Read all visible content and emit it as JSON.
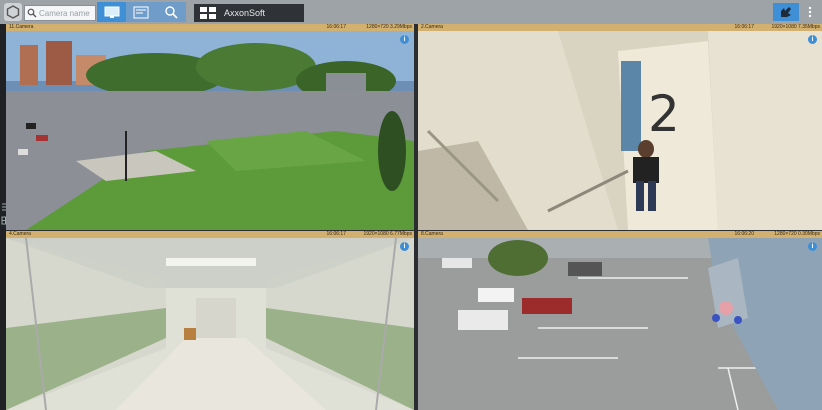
{
  "toolbar": {
    "search_placeholder": "Camera name",
    "layout_name": "AxxonSoft"
  },
  "cameras": [
    {
      "name": "11.Camera",
      "time": "16:06:17",
      "resolution": "1280×720 3.29Mbps"
    },
    {
      "name": "2.Camera",
      "time": "16:06:17",
      "resolution": "1920×1080 7.35Mbps"
    },
    {
      "name": "4.Camera",
      "time": "16:06:17",
      "resolution": "1920×1080 6.77Mbps"
    },
    {
      "name": "8.Camera",
      "time": "16:06:20",
      "resolution": "1280×720 0.30Mbps"
    }
  ],
  "scene_text": {
    "floor_number": "2"
  },
  "colors": {
    "accent": "#3e8fd6",
    "header_bar": "#d2b070",
    "toolbar_bg": "#9ea3a8"
  },
  "icons": {
    "logo": "hexagon-logo-icon",
    "search": "search-icon",
    "monitor": "monitor-icon",
    "map": "map-icon",
    "zoom": "zoom-icon",
    "layout": "layout-grid-icon",
    "alarm": "alarm-hand-icon",
    "menu": "menu-icon"
  }
}
